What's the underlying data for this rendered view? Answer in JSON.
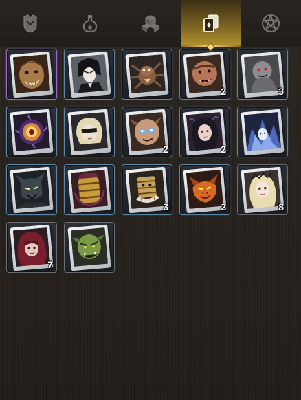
{
  "tabs": [
    {
      "icon": "armor-icon",
      "active": false
    },
    {
      "icon": "potion-icon",
      "active": false
    },
    {
      "icon": "materials-icon",
      "active": false
    },
    {
      "icon": "cards-icon",
      "active": true
    },
    {
      "icon": "pentagram-icon",
      "active": false
    }
  ],
  "cards": [
    {
      "name": "card-ogre",
      "count": "",
      "rarity": "purple"
    },
    {
      "name": "card-dark-swordsman",
      "count": "",
      "rarity": "blue"
    },
    {
      "name": "card-spider",
      "count": "",
      "rarity": "blue"
    },
    {
      "name": "card-brute",
      "count": "2",
      "rarity": "blue"
    },
    {
      "name": "card-grey-beast",
      "count": "3",
      "rarity": "blue"
    },
    {
      "name": "card-eye-orb",
      "count": "",
      "rarity": "blue"
    },
    {
      "name": "card-blonde-masked",
      "count": "",
      "rarity": "blue"
    },
    {
      "name": "card-goblin-blue-eyes",
      "count": "2",
      "rarity": "blue"
    },
    {
      "name": "card-dark-maiden",
      "count": "2",
      "rarity": "blue"
    },
    {
      "name": "card-frost-spirit",
      "count": "",
      "rarity": "blue"
    },
    {
      "name": "card-shadow-knight",
      "count": "",
      "rarity": "blue"
    },
    {
      "name": "card-golden-barrel",
      "count": "",
      "rarity": "blue"
    },
    {
      "name": "card-barrel-golem",
      "count": "3",
      "rarity": "blue"
    },
    {
      "name": "card-fire-dragon",
      "count": "2",
      "rarity": "blue"
    },
    {
      "name": "card-blonde-doll",
      "count": "8",
      "rarity": "plain"
    },
    {
      "name": "card-red-haired-girl",
      "count": "7",
      "rarity": "plain"
    },
    {
      "name": "card-green-orc",
      "count": "",
      "rarity": "plain"
    }
  ]
}
